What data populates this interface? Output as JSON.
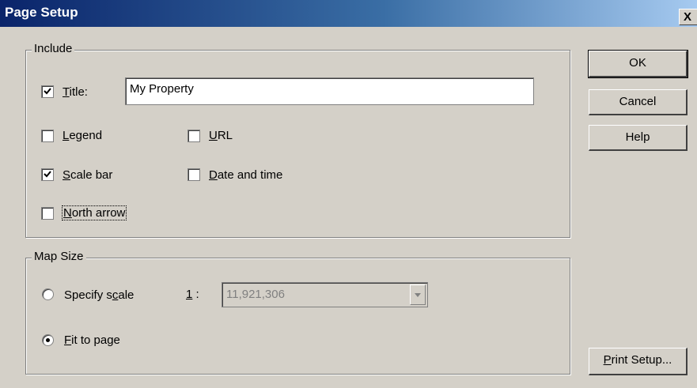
{
  "window": {
    "title": "Page Setup",
    "close_label": "X"
  },
  "include": {
    "label": "Include",
    "title_checkbox": {
      "label": "Title:",
      "accesskey": "T",
      "checked": true
    },
    "title_value": "My Property",
    "legend": {
      "label": "Legend",
      "accesskey": "L",
      "checked": false
    },
    "url": {
      "label": "URL",
      "accesskey": "U",
      "checked": false
    },
    "scale_bar": {
      "label": "Scale bar",
      "accesskey": "S",
      "checked": true
    },
    "date_time": {
      "label": "Date and time",
      "accesskey": "D",
      "checked": false
    },
    "north_arrow": {
      "label": "North arrow",
      "accesskey": "N",
      "checked": false
    }
  },
  "map_size": {
    "label": "Map Size",
    "specify_scale": {
      "label": "Specify scale",
      "selected": false
    },
    "scale_prefix": "1 :",
    "scale_value": "11,921,306",
    "fit_to_page": {
      "label": "Fit to page",
      "selected": true
    }
  },
  "buttons": {
    "ok": "OK",
    "cancel": "Cancel",
    "help": "Help",
    "print_setup": "Print Setup..."
  }
}
